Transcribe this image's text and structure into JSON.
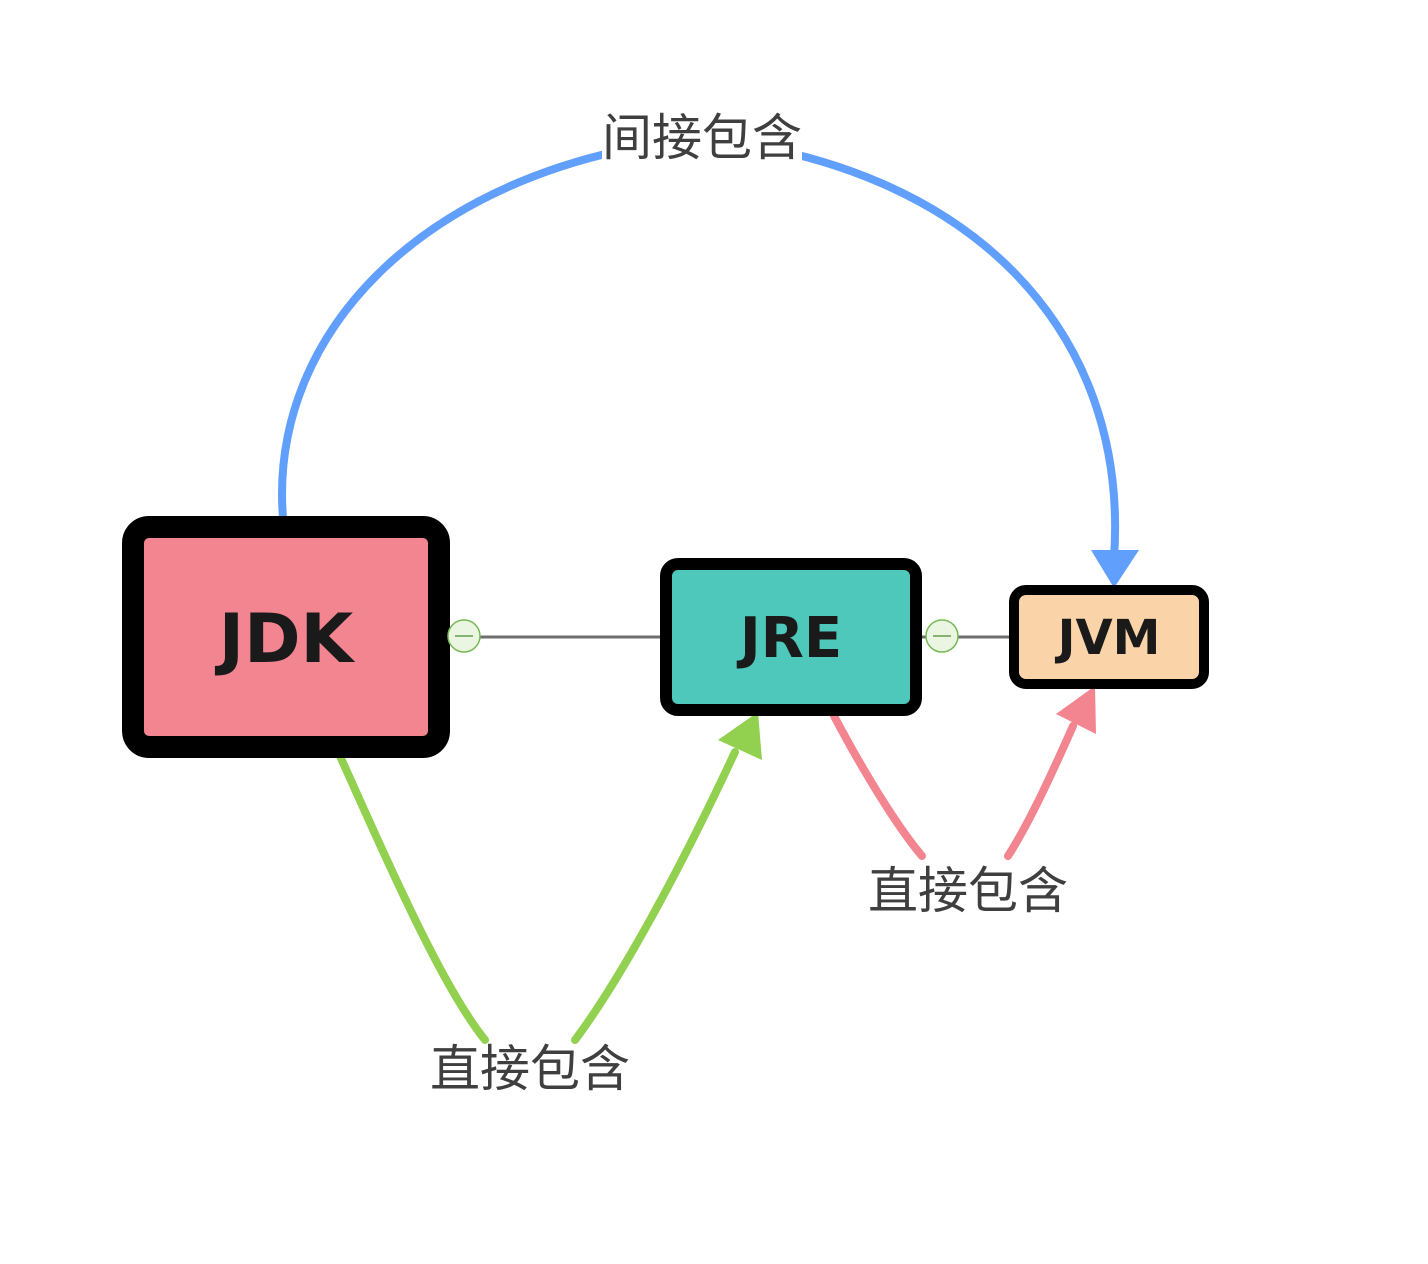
{
  "nodes": {
    "jdk": {
      "label": "JDK",
      "fill": "#f2858f",
      "border": "#000000"
    },
    "jre": {
      "label": "JRE",
      "fill": "#4fc8bc",
      "border": "#000000"
    },
    "jvm": {
      "label": "JVM",
      "fill": "#fad4a8",
      "border": "#000000"
    }
  },
  "edges": {
    "jdk_to_jvm": {
      "label": "间接包含",
      "color": "#619ffd"
    },
    "jdk_to_jre": {
      "label": "直接包含",
      "color": "#92d050"
    },
    "jre_to_jvm": {
      "label": "直接包含",
      "color": "#f2858f"
    }
  },
  "connector_color": "#6e6e6e",
  "collapse_button_icon": "minus-circle-icon"
}
